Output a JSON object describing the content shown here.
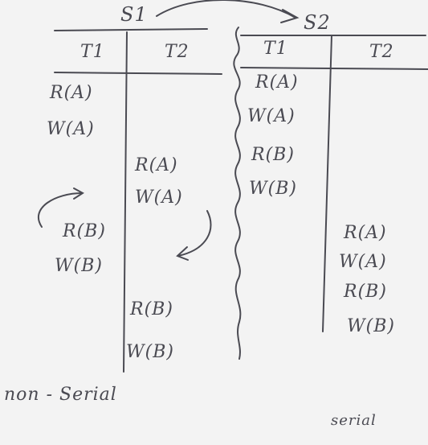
{
  "schedules": {
    "s1": {
      "title": "S1",
      "headers": [
        "T1",
        "T2"
      ],
      "operations": [
        "R(A)",
        "W(A)",
        "R(A)",
        "W(A)",
        "R(B)",
        "W(B)",
        "R(B)",
        "W(B)"
      ]
    },
    "s2": {
      "title": "S2",
      "headers": [
        "T1",
        "T2"
      ],
      "operations": [
        "R(A)",
        "W(A)",
        "R(B)",
        "W(B)",
        "R(A)",
        "W(A)",
        "R(B)",
        "W(B)"
      ]
    }
  },
  "notes": {
    "non_serial": "non - Serial",
    "serial": "serial"
  },
  "colors": {
    "board": "#f3f3f3",
    "ink": "#4a4a52"
  }
}
